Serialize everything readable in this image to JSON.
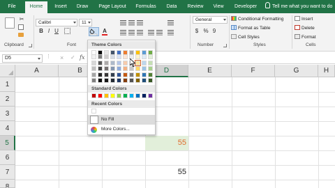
{
  "tabs": [
    {
      "label": "File",
      "active": false
    },
    {
      "label": "Home",
      "active": true
    },
    {
      "label": "Insert",
      "active": false
    },
    {
      "label": "Draw",
      "active": false
    },
    {
      "label": "Page Layout",
      "active": false
    },
    {
      "label": "Formulas",
      "active": false
    },
    {
      "label": "Data",
      "active": false
    },
    {
      "label": "Review",
      "active": false
    },
    {
      "label": "View",
      "active": false
    },
    {
      "label": "Developer",
      "active": false
    }
  ],
  "tell_me": "Tell me what you want to do",
  "ribbon": {
    "groups": {
      "clipboard": "Clipboard",
      "font": "Font",
      "number": "Number",
      "styles": "Styles",
      "cells": "Cells"
    },
    "font_name": "Calibri",
    "font_size": "11",
    "number_format": "General",
    "number_symbols": {
      "currency": "$",
      "percent": "%",
      "comma": "9"
    },
    "conditional_formatting": "Conditional Formatting",
    "format_as_table": "Format as Table",
    "cell_styles": "Cell Styles",
    "insert": "Insert",
    "delete": "Delete",
    "format": "Format"
  },
  "name_box": "D5",
  "formula_symbols": {
    "cancel": "×",
    "enter": "✓",
    "fx": "fx"
  },
  "columns": [
    "A",
    "B",
    "C",
    "D",
    "E",
    "F",
    "G",
    "H"
  ],
  "rows": [
    "1",
    "2",
    "3",
    "4",
    "5",
    "6",
    "7",
    "8"
  ],
  "cells": {
    "d5": "55",
    "d7": "55"
  },
  "cell_colors": {
    "d5_fill": "#e2efda",
    "d5_text": "#e06a2a"
  },
  "color_menu": {
    "theme_header": "Theme Colors",
    "standard_header": "Standard Colors",
    "recent_header": "Recent Colors",
    "no_fill": "No Fill",
    "more_colors": "More Colors..."
  },
  "theme_colors": [
    [
      "#ffffff",
      "#000000",
      "#e7e6e6",
      "#44546a",
      "#4472c4",
      "#ed7d31",
      "#a5a5a5",
      "#ffc000",
      "#5b9bd5",
      "#70ad47"
    ],
    [
      "#f2f2f2",
      "#7f7f7f",
      "#d0cece",
      "#d6dce4",
      "#d9e2f3",
      "#fbe5d5",
      "#ededed",
      "#fff2cc",
      "#deebf6",
      "#e2efd9"
    ],
    [
      "#d8d8d8",
      "#595959",
      "#aeabab",
      "#adb9ca",
      "#b4c6e7",
      "#f7cbac",
      "#dbdbdb",
      "#fee599",
      "#bdd7ee",
      "#c5e0b3"
    ],
    [
      "#bfbfbf",
      "#3f3f3f",
      "#757070",
      "#8496b0",
      "#8eaadb",
      "#f4b183",
      "#c9c9c9",
      "#ffd965",
      "#9cc3e5",
      "#a8d08d"
    ],
    [
      "#a5a5a5",
      "#262626",
      "#3a3838",
      "#323f4f",
      "#2f5496",
      "#c55a11",
      "#7b7b7b",
      "#bf8f00",
      "#2e75b5",
      "#538135"
    ],
    [
      "#7f7f7f",
      "#0c0c0c",
      "#171616",
      "#222a35",
      "#1f3864",
      "#833c0b",
      "#525252",
      "#7f6000",
      "#1e4e79",
      "#375623"
    ]
  ],
  "standard_colors": [
    "#c00000",
    "#ff0000",
    "#ffc000",
    "#ffff00",
    "#92d050",
    "#00b050",
    "#00b0f0",
    "#0070c0",
    "#002060",
    "#7030a0"
  ],
  "recent_colors": [
    "#ffffff"
  ],
  "accent_color": "#217346"
}
